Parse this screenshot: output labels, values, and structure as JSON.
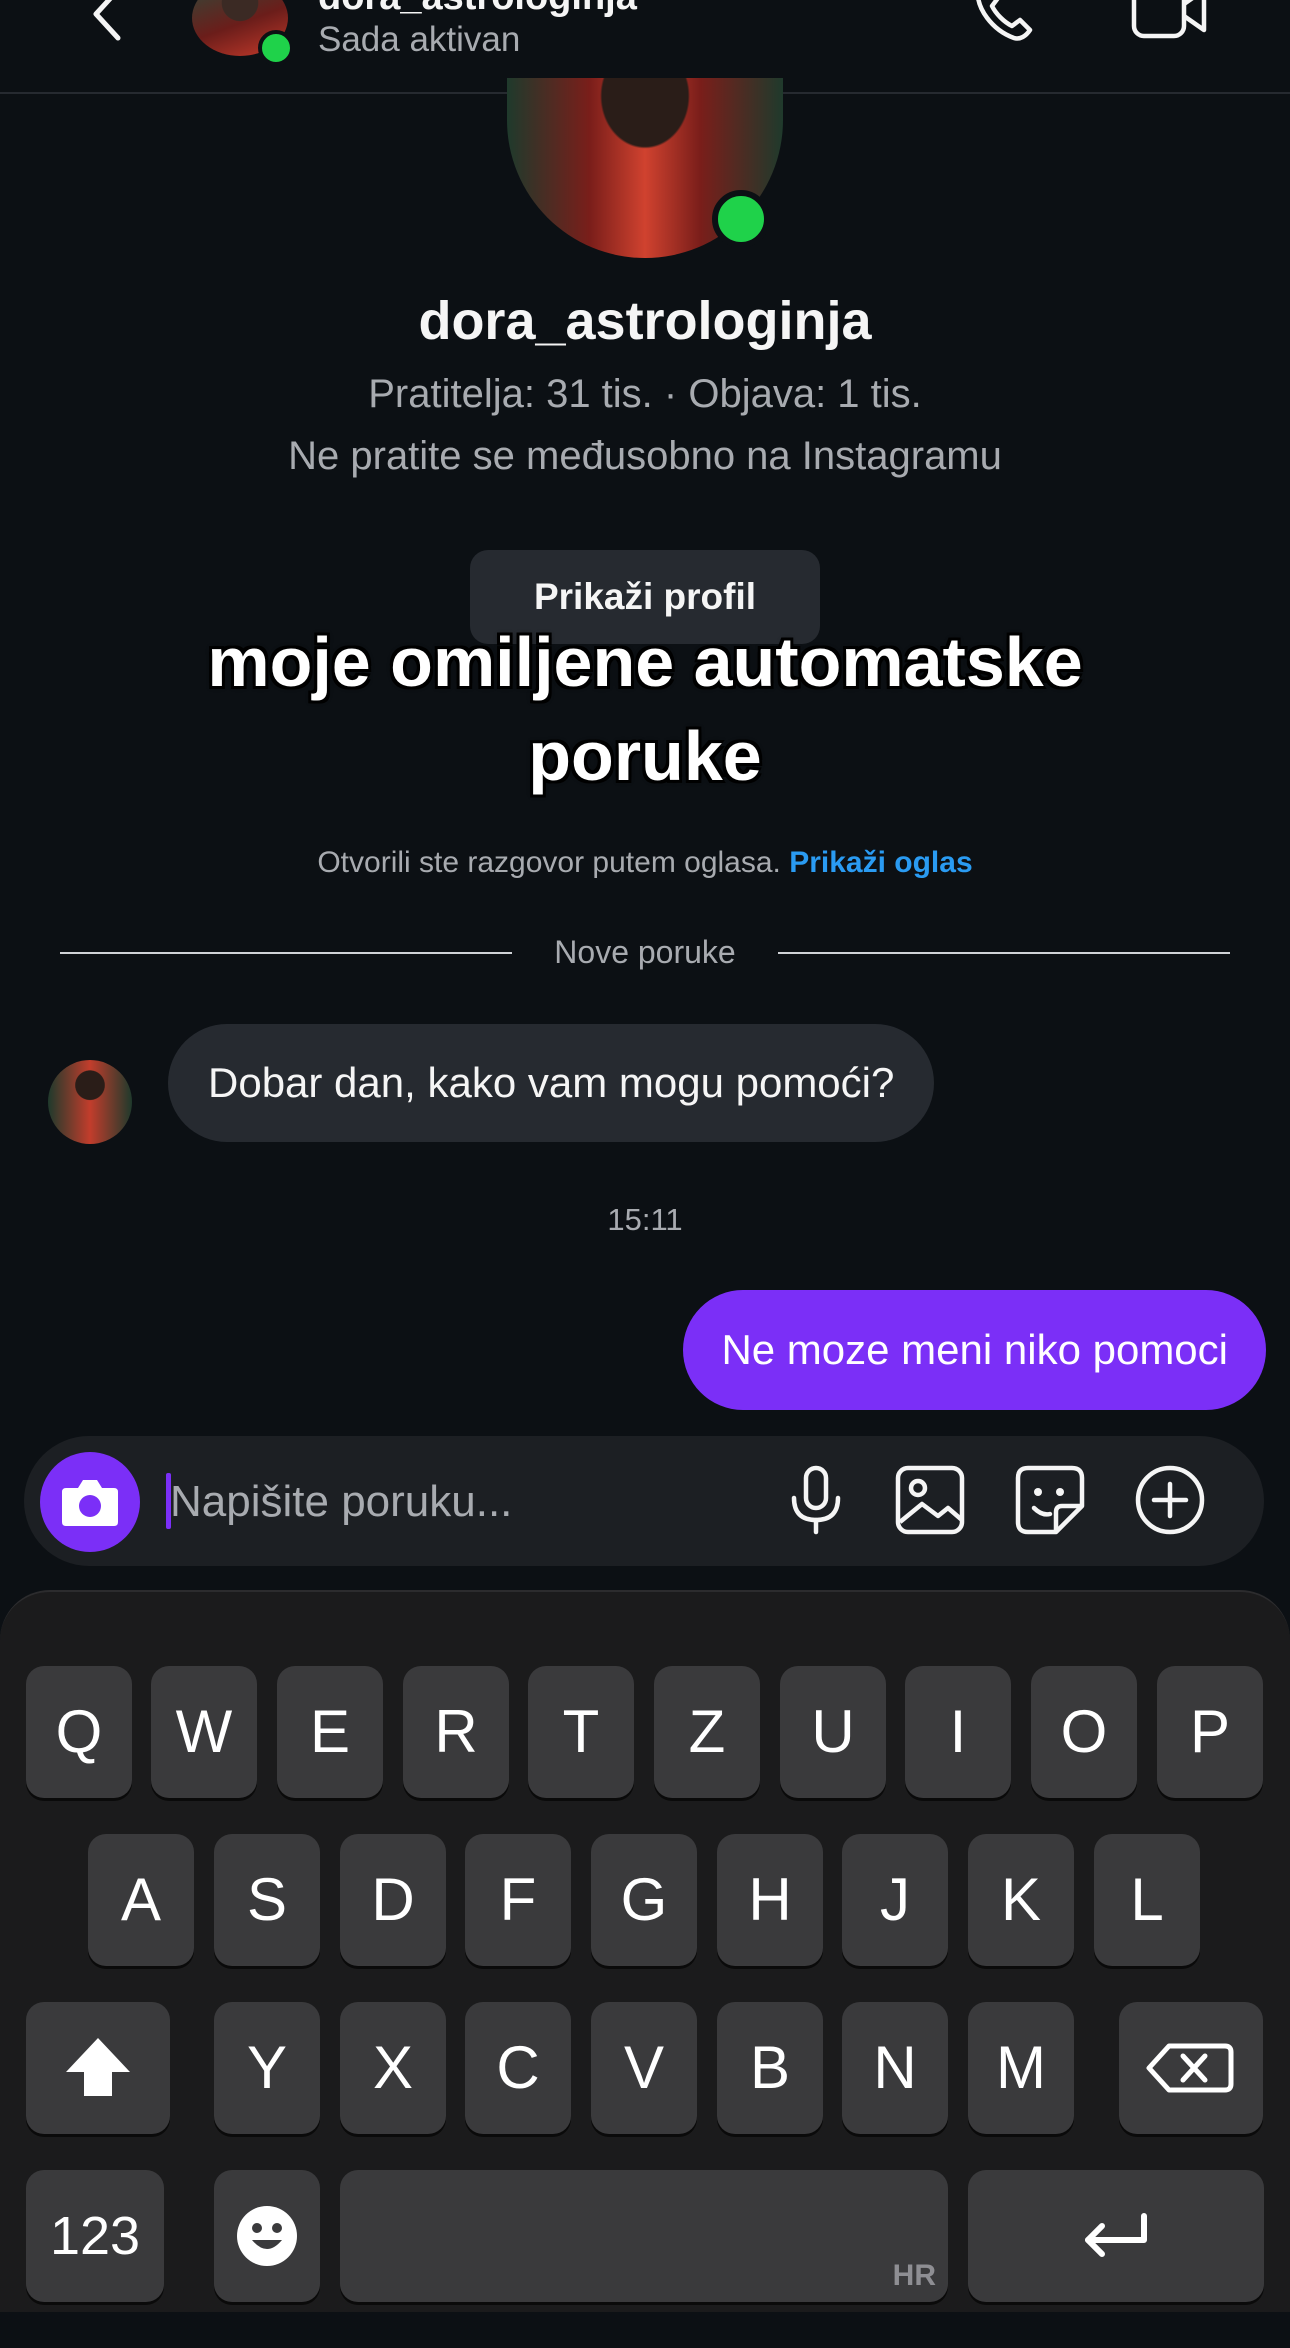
{
  "header": {
    "username": "dora_astrologinja",
    "status": "Sada aktivan"
  },
  "profile": {
    "username": "dora_astrologinja",
    "stats": "Pratitelja: 31 tis. · Objava: 1 tis.",
    "mutual_note": "Ne pratite se međusobno na Instagramu",
    "view_profile_label": "Prikaži profil"
  },
  "overlay_caption": "moje omiljene automatske poruke",
  "ad_notice": {
    "text": "Otvorili ste razgovor putem oglasa. ",
    "link": "Prikaži oglas"
  },
  "divider_label": "Nove poruke",
  "messages": {
    "incoming": "Dobar dan, kako vam mogu pomoći?",
    "timestamp": "15:11",
    "outgoing": "Ne moze meni niko pomoci"
  },
  "composer": {
    "placeholder": "Napišite poruku...",
    "value": ""
  },
  "keyboard": {
    "row1": [
      "Q",
      "W",
      "E",
      "R",
      "T",
      "Z",
      "U",
      "I",
      "O",
      "P"
    ],
    "row2": [
      "A",
      "S",
      "D",
      "F",
      "G",
      "H",
      "J",
      "K",
      "L"
    ],
    "row3": [
      "Y",
      "X",
      "C",
      "V",
      "B",
      "N",
      "M"
    ],
    "numbers_label": "123",
    "space_language": "HR"
  },
  "colors": {
    "background": "#0c1014",
    "accent_purple": "#7b2ff7",
    "online_green": "#1fd24a",
    "link_blue": "#2a9bf2"
  },
  "icons": [
    "back-arrow-icon",
    "phone-icon",
    "video-camera-icon",
    "camera-icon",
    "microphone-icon",
    "image-icon",
    "sticker-icon",
    "plus-circle-icon",
    "shift-icon",
    "backspace-icon",
    "emoji-icon",
    "return-icon"
  ]
}
